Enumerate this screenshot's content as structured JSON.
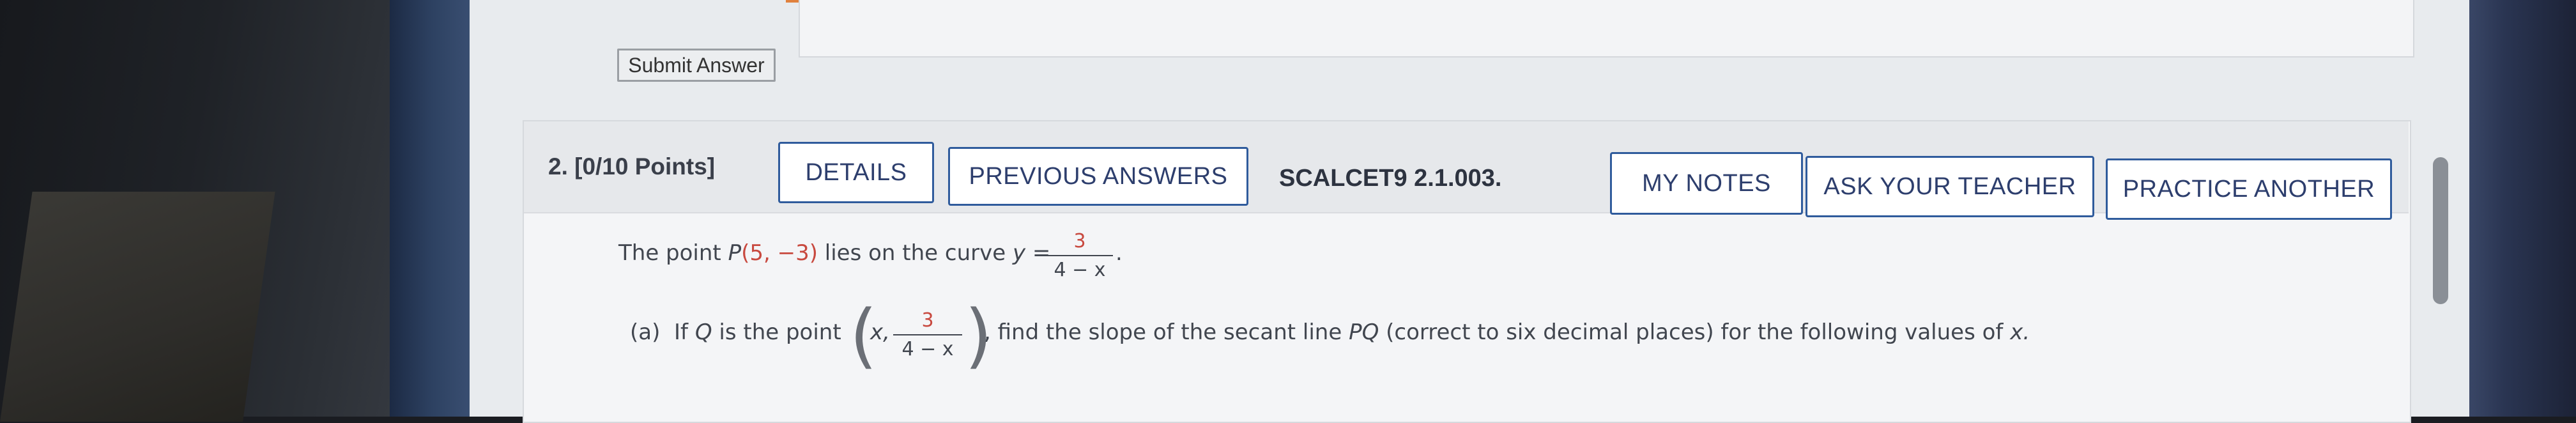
{
  "previous": {
    "submit_label": "Submit Answer"
  },
  "question": {
    "number_points": "2.  [0/10 Points]",
    "buttons": {
      "details": "DETAILS",
      "previous_answers": "PREVIOUS ANSWERS",
      "my_notes": "MY NOTES",
      "ask_teacher": "ASK YOUR TEACHER",
      "practice_another": "PRACTICE ANOTHER"
    },
    "code": "SCALCET9 2.1.003.",
    "statement": {
      "prefix": "The point ",
      "point_name": "P",
      "point_coords": "(5, −3)",
      "mid": " lies on the curve ",
      "y_eq": "y =",
      "frac_num": "3",
      "frac_den": "4 − x",
      "end": "."
    },
    "part_a": {
      "label": "(a)",
      "if_text": "If",
      "q_var": "Q",
      "is_point": "is the point",
      "x_var": "x,",
      "frac_num": "3",
      "frac_den": "4 − x",
      "rest": ", find the slope of the secant line",
      "pq": "PQ",
      "rest2": "(correct to six decimal places) for the following values of",
      "x_end": "x."
    }
  }
}
